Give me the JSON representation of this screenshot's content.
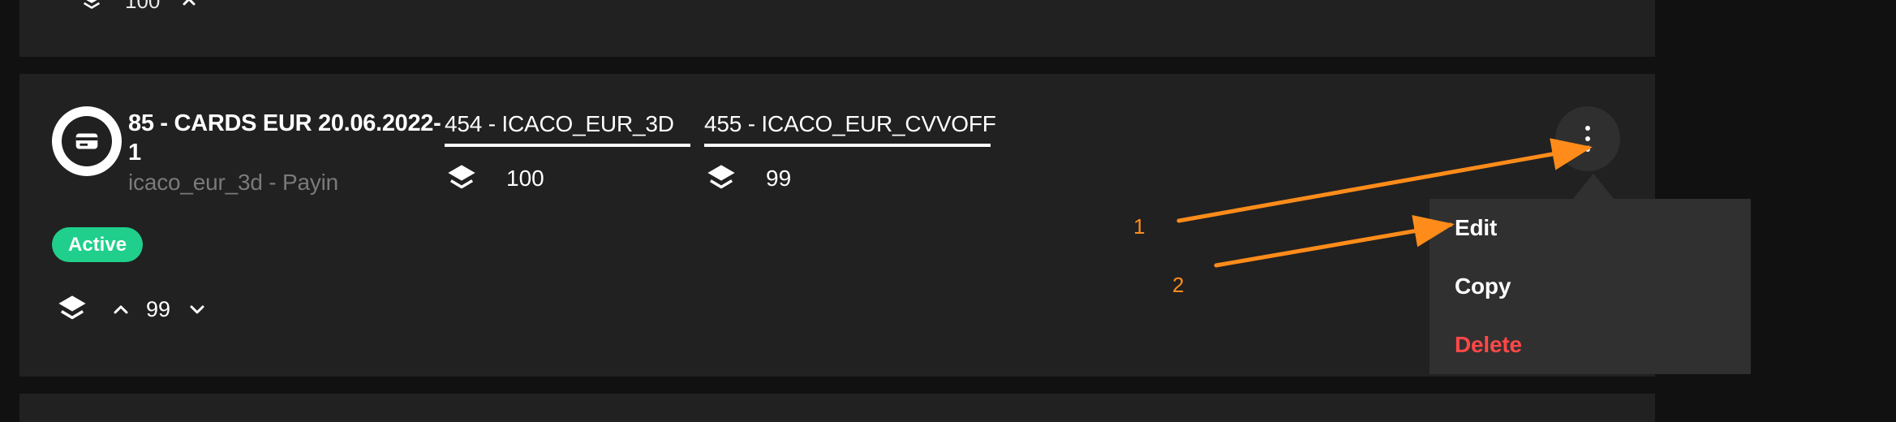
{
  "previous_row": {
    "count": "100"
  },
  "route": {
    "title": "85 - CARDS EUR 20.06.2022-1",
    "subtitle": "icaco_eur_3d - Payin",
    "status": "Active",
    "status_color": "#1fcf8b",
    "icon": "card-icon",
    "providers": [
      {
        "label": "454 - ICACO_EUR_3D",
        "count": "100",
        "icon": "layers-icon"
      },
      {
        "label": "455 - ICACO_EUR_CVVOFF",
        "count": "99",
        "icon": "layers-icon"
      }
    ],
    "priority": {
      "value": "99",
      "icon": "layers-icon",
      "increase_icon": "chevron-up-icon",
      "decrease_icon": "chevron-down-icon"
    },
    "more_icon": "more-vertical-icon"
  },
  "context_menu": {
    "items": [
      {
        "label": "Edit",
        "color": "#ffffff"
      },
      {
        "label": "Copy",
        "color": "#ffffff"
      },
      {
        "label": "Delete",
        "color": "#ff4848"
      }
    ]
  },
  "annotations": {
    "color": "#ff8c1a",
    "labels": [
      "1",
      "2"
    ]
  }
}
